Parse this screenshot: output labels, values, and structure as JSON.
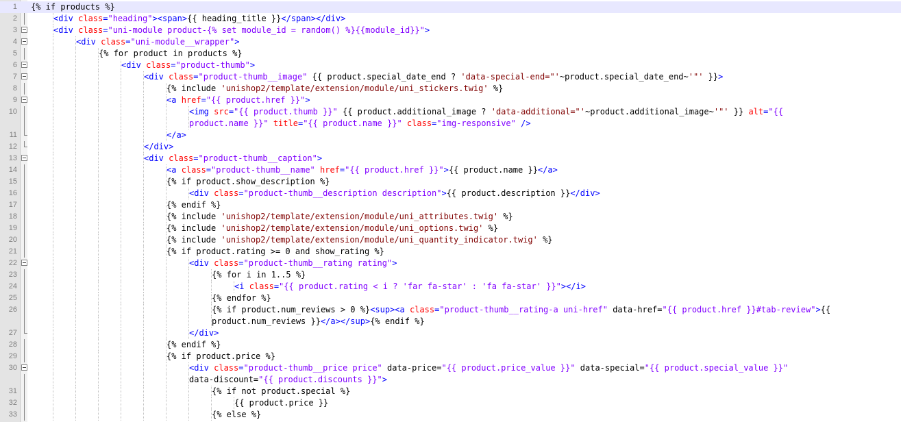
{
  "editor": {
    "colors": {
      "tag": "#0000ff",
      "attr": "#ff0000",
      "string": "#8000ff",
      "text": "#000000",
      "current_line": "#e8e8ff"
    },
    "icons": {
      "fold_marker": "fold-box-minus-icon"
    },
    "lines": [
      {
        "n": "1",
        "fold": "",
        "ind": 0,
        "segs": [
          [
            "twig",
            "{% if products %}"
          ]
        ]
      },
      {
        "n": "2",
        "fold": "line",
        "ind": 1,
        "segs": [
          [
            "tag",
            "<div "
          ],
          [
            "attr",
            "class"
          ],
          [
            "tag",
            "="
          ],
          [
            "str",
            "\"heading\""
          ],
          [
            "tag",
            "><span>"
          ],
          [
            "ptext",
            "{{ heading_title }}"
          ],
          [
            "tag",
            "</span></div>"
          ]
        ]
      },
      {
        "n": "3",
        "fold": "box",
        "ind": 1,
        "segs": [
          [
            "tag",
            "<div "
          ],
          [
            "attr",
            "class"
          ],
          [
            "tag",
            "="
          ],
          [
            "str",
            "\"uni-module product-{% set module_id = random() %}{{module_id}}\""
          ],
          [
            "tag",
            ">"
          ]
        ]
      },
      {
        "n": "4",
        "fold": "box",
        "ind": 2,
        "segs": [
          [
            "tag",
            "<div "
          ],
          [
            "attr",
            "class"
          ],
          [
            "tag",
            "="
          ],
          [
            "str",
            "\"uni-module__wrapper\""
          ],
          [
            "tag",
            ">"
          ]
        ]
      },
      {
        "n": "5",
        "fold": "line",
        "ind": 3,
        "segs": [
          [
            "twig",
            "{% for product in products %}"
          ]
        ]
      },
      {
        "n": "6",
        "fold": "box",
        "ind": 4,
        "segs": [
          [
            "tag",
            "<div "
          ],
          [
            "attr",
            "class"
          ],
          [
            "tag",
            "="
          ],
          [
            "str",
            "\"product-thumb\""
          ],
          [
            "tag",
            ">"
          ]
        ]
      },
      {
        "n": "7",
        "fold": "box",
        "ind": 5,
        "segs": [
          [
            "tag",
            "<div "
          ],
          [
            "attr",
            "class"
          ],
          [
            "tag",
            "="
          ],
          [
            "str",
            "\"product-thumb__image\""
          ],
          [
            "ptext",
            " {{ product.special_date_end ? "
          ],
          [
            "twigstr",
            "'data-special-end=\"'"
          ],
          [
            "ptext",
            "~product.special_date_end~"
          ],
          [
            "twigstr",
            "'\"'"
          ],
          [
            "ptext",
            " }}"
          ],
          [
            "tag",
            ">"
          ]
        ]
      },
      {
        "n": "8",
        "fold": "line",
        "ind": 6,
        "segs": [
          [
            "twig",
            "{% include "
          ],
          [
            "twigstr",
            "'unishop2/template/extension/module/uni_stickers.twig'"
          ],
          [
            "twig",
            " %}"
          ]
        ]
      },
      {
        "n": "9",
        "fold": "box",
        "ind": 6,
        "segs": [
          [
            "tag",
            "<a "
          ],
          [
            "attr",
            "href"
          ],
          [
            "tag",
            "="
          ],
          [
            "str",
            "\"{{ product.href }}\""
          ],
          [
            "tag",
            ">"
          ]
        ]
      },
      {
        "n": "10",
        "fold": "line",
        "ind": 7,
        "segs": [
          [
            "tag",
            "<img "
          ],
          [
            "attr",
            "src"
          ],
          [
            "tag",
            "="
          ],
          [
            "str",
            "\"{{ product.thumb }}\""
          ],
          [
            "ptext",
            " {{ product.additional_image ? "
          ],
          [
            "twigstr",
            "'data-additional=\"'"
          ],
          [
            "ptext",
            "~product.additional_image~"
          ],
          [
            "twigstr",
            "'\"'"
          ],
          [
            "ptext",
            " }} "
          ],
          [
            "attr",
            "alt"
          ],
          [
            "tag",
            "="
          ],
          [
            "str",
            "\"{{"
          ]
        ]
      },
      {
        "n": "",
        "fold": "line",
        "ind": 7,
        "segs": [
          [
            "str",
            "product.name }}\""
          ],
          [
            "ptext",
            " "
          ],
          [
            "attr",
            "title"
          ],
          [
            "tag",
            "="
          ],
          [
            "str",
            "\"{{ product.name }}\""
          ],
          [
            "ptext",
            " "
          ],
          [
            "attr",
            "class"
          ],
          [
            "tag",
            "="
          ],
          [
            "str",
            "\"img-responsive\""
          ],
          [
            "tag",
            " />"
          ]
        ]
      },
      {
        "n": "11",
        "fold": "end",
        "ind": 6,
        "segs": [
          [
            "tag",
            "</a>"
          ]
        ]
      },
      {
        "n": "12",
        "fold": "end",
        "ind": 5,
        "segs": [
          [
            "tag",
            "</div>"
          ]
        ]
      },
      {
        "n": "13",
        "fold": "box",
        "ind": 5,
        "segs": [
          [
            "tag",
            "<div "
          ],
          [
            "attr",
            "class"
          ],
          [
            "tag",
            "="
          ],
          [
            "str",
            "\"product-thumb__caption\""
          ],
          [
            "tag",
            ">"
          ]
        ]
      },
      {
        "n": "14",
        "fold": "line",
        "ind": 6,
        "segs": [
          [
            "tag",
            "<a "
          ],
          [
            "attr",
            "class"
          ],
          [
            "tag",
            "="
          ],
          [
            "str",
            "\"product-thumb__name\""
          ],
          [
            "ptext",
            " "
          ],
          [
            "attr",
            "href"
          ],
          [
            "tag",
            "="
          ],
          [
            "str",
            "\"{{ product.href }}\""
          ],
          [
            "tag",
            ">"
          ],
          [
            "ptext",
            "{{ product.name }}"
          ],
          [
            "tag",
            "</a>"
          ]
        ]
      },
      {
        "n": "15",
        "fold": "line",
        "ind": 6,
        "segs": [
          [
            "twig",
            "{% if product.show_description %}"
          ]
        ]
      },
      {
        "n": "16",
        "fold": "line",
        "ind": 7,
        "segs": [
          [
            "tag",
            "<div "
          ],
          [
            "attr",
            "class"
          ],
          [
            "tag",
            "="
          ],
          [
            "str",
            "\"product-thumb__description description\""
          ],
          [
            "tag",
            ">"
          ],
          [
            "ptext",
            "{{ product.description }}"
          ],
          [
            "tag",
            "</div>"
          ]
        ]
      },
      {
        "n": "17",
        "fold": "line",
        "ind": 6,
        "segs": [
          [
            "twig",
            "{% endif %}"
          ]
        ]
      },
      {
        "n": "18",
        "fold": "line",
        "ind": 6,
        "segs": [
          [
            "twig",
            "{% include "
          ],
          [
            "twigstr",
            "'unishop2/template/extension/module/uni_attributes.twig'"
          ],
          [
            "twig",
            " %}"
          ]
        ]
      },
      {
        "n": "19",
        "fold": "line",
        "ind": 6,
        "segs": [
          [
            "twig",
            "{% include "
          ],
          [
            "twigstr",
            "'unishop2/template/extension/module/uni_options.twig'"
          ],
          [
            "twig",
            " %}"
          ]
        ]
      },
      {
        "n": "20",
        "fold": "line",
        "ind": 6,
        "segs": [
          [
            "twig",
            "{% include "
          ],
          [
            "twigstr",
            "'unishop2/template/extension/module/uni_quantity_indicator.twig'"
          ],
          [
            "twig",
            " %}"
          ]
        ]
      },
      {
        "n": "21",
        "fold": "line",
        "ind": 6,
        "segs": [
          [
            "twig",
            "{% if product.rating >= 0 and show_rating %}"
          ]
        ]
      },
      {
        "n": "22",
        "fold": "box",
        "ind": 7,
        "segs": [
          [
            "tag",
            "<div "
          ],
          [
            "attr",
            "class"
          ],
          [
            "tag",
            "="
          ],
          [
            "str",
            "\"product-thumb__rating rating\""
          ],
          [
            "tag",
            ">"
          ]
        ]
      },
      {
        "n": "23",
        "fold": "line",
        "ind": 8,
        "segs": [
          [
            "twig",
            "{% for i in 1..5 %}"
          ]
        ]
      },
      {
        "n": "24",
        "fold": "line",
        "ind": 9,
        "segs": [
          [
            "tag",
            "<i "
          ],
          [
            "attr",
            "class"
          ],
          [
            "tag",
            "="
          ],
          [
            "str",
            "\"{{ product.rating < i ? 'far fa-star' : 'fa fa-star' }}\""
          ],
          [
            "tag",
            "></i>"
          ]
        ]
      },
      {
        "n": "25",
        "fold": "line",
        "ind": 8,
        "segs": [
          [
            "twig",
            "{% endfor %}"
          ]
        ]
      },
      {
        "n": "26",
        "fold": "line",
        "ind": 8,
        "segs": [
          [
            "twig",
            "{% if product.num_reviews > 0 %}"
          ],
          [
            "tag",
            "<sup><a "
          ],
          [
            "attr",
            "class"
          ],
          [
            "tag",
            "="
          ],
          [
            "str",
            "\"product-thumb__rating-a uni-href\""
          ],
          [
            "ptext",
            " data-href="
          ],
          [
            "str",
            "\"{{ product.href }}#tab-review\""
          ],
          [
            "tag",
            ">"
          ],
          [
            "ptext",
            "{{"
          ]
        ]
      },
      {
        "n": "",
        "fold": "line",
        "ind": 8,
        "segs": [
          [
            "ptext",
            "product.num_reviews }}"
          ],
          [
            "tag",
            "</a></sup>"
          ],
          [
            "twig",
            "{% endif %}"
          ]
        ]
      },
      {
        "n": "27",
        "fold": "end",
        "ind": 7,
        "segs": [
          [
            "tag",
            "</div>"
          ]
        ]
      },
      {
        "n": "28",
        "fold": "line",
        "ind": 6,
        "segs": [
          [
            "twig",
            "{% endif %}"
          ]
        ]
      },
      {
        "n": "29",
        "fold": "line",
        "ind": 6,
        "segs": [
          [
            "twig",
            "{% if product.price %}"
          ]
        ]
      },
      {
        "n": "30",
        "fold": "box",
        "ind": 7,
        "segs": [
          [
            "tag",
            "<div "
          ],
          [
            "attr",
            "class"
          ],
          [
            "tag",
            "="
          ],
          [
            "str",
            "\"product-thumb__price price\""
          ],
          [
            "ptext",
            " data-price="
          ],
          [
            "str",
            "\"{{ product.price_value }}\""
          ],
          [
            "ptext",
            " data-special="
          ],
          [
            "str",
            "\"{{ product.special_value }}\""
          ]
        ]
      },
      {
        "n": "",
        "fold": "line",
        "ind": 7,
        "segs": [
          [
            "ptext",
            "data-discount="
          ],
          [
            "str",
            "\"{{ product.discounts }}\""
          ],
          [
            "tag",
            ">"
          ]
        ]
      },
      {
        "n": "31",
        "fold": "line",
        "ind": 8,
        "segs": [
          [
            "twig",
            "{% if not product.special %}"
          ]
        ]
      },
      {
        "n": "32",
        "fold": "line",
        "ind": 9,
        "segs": [
          [
            "ptext",
            "{{ product.price }}"
          ]
        ]
      },
      {
        "n": "33",
        "fold": "line",
        "ind": 8,
        "segs": [
          [
            "twig",
            "{% else %}"
          ]
        ]
      }
    ]
  }
}
